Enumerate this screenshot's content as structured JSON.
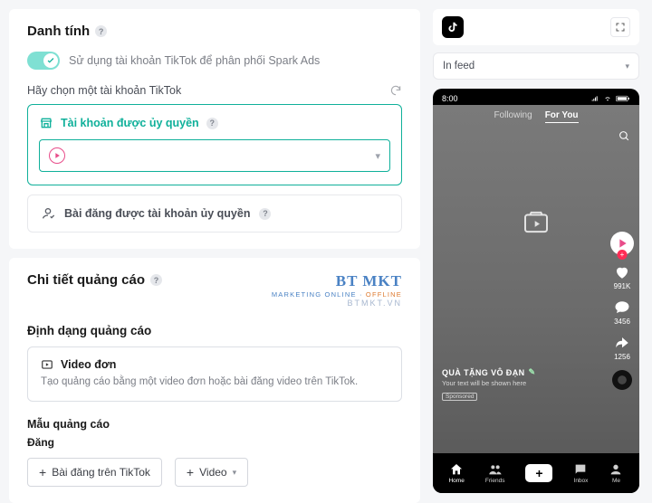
{
  "identity": {
    "title": "Danh tính",
    "toggle_label": "Sử dụng tài khoản TikTok để phân phối Spark Ads",
    "choose_label": "Hãy chọn một tài khoản TikTok",
    "auth_account_label": "Tài khoản được ủy quyền",
    "account_select_value": "",
    "auth_post_label": "Bài đăng được tài khoản ủy quyền"
  },
  "adDetail": {
    "title": "Chi tiết quảng cáo",
    "format_heading": "Định dạng quảng cáo",
    "format_name": "Video đơn",
    "format_desc": "Tạo quảng cáo bằng một video đơn hoặc bài đăng video trên TikTok.",
    "template_heading": "Mẫu quảng cáo",
    "post_heading": "Đăng",
    "btn_tiktok_post": "Bài đăng trên TikTok",
    "btn_video": "Video"
  },
  "watermark": {
    "line1": "BT MKT",
    "line2a": "MARKETING ONLINE",
    "line2b": "OFFLINE",
    "line3": "BTMKT.VN"
  },
  "preview": {
    "placement": "In feed",
    "clock": "8:00",
    "tab_following": "Following",
    "tab_foryou": "For You",
    "likes": "991K",
    "comments": "3456",
    "shares": "1256",
    "caption_title": "QUÀ TẶNG VÔ ĐẠN",
    "caption_sub": "Your text will be shown here",
    "sponsored": "Sponsored",
    "nav_home": "Home",
    "nav_friends": "Friends",
    "nav_inbox": "Inbox",
    "nav_me": "Me"
  }
}
